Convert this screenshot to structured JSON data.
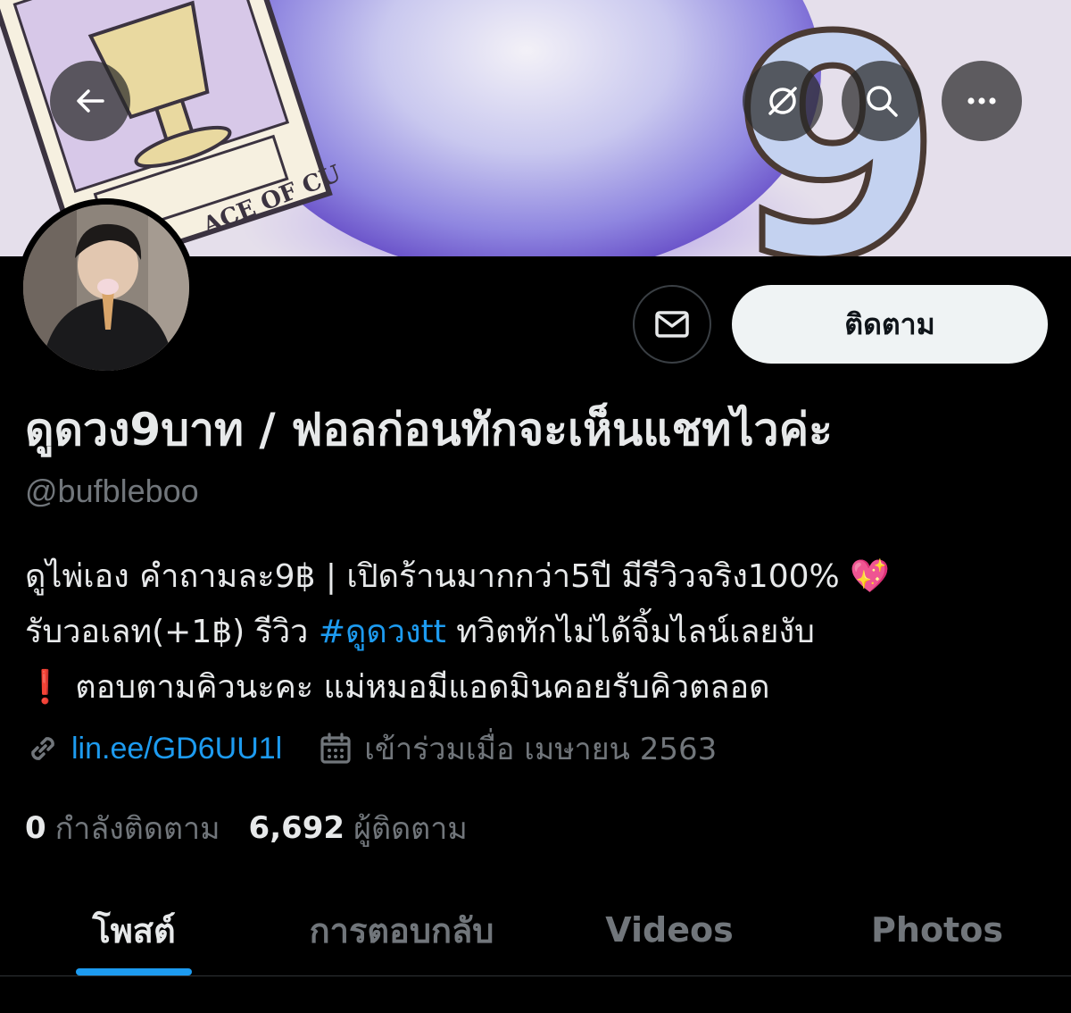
{
  "header": {
    "back_icon": "arrow-left-icon",
    "actions": [
      {
        "icon": "no-notification-icon"
      },
      {
        "icon": "search-icon"
      },
      {
        "icon": "more-horizontal-icon"
      }
    ]
  },
  "banner": {
    "card_text": "ACE OF CU",
    "big_digit": "9"
  },
  "actions": {
    "message_icon": "envelope-icon",
    "follow_label": "ติดตาม"
  },
  "profile": {
    "display_name": "ดูดวง9บาท / ฟอลก่อนทักจะเห็นแชทไวค่ะ",
    "handle": "@bufbleboo",
    "bio": {
      "line1": "ดูไพ่เอง คำถามละ9฿ | เปิดร้านมากกว่า5ปี มีรีวิวจริง100%",
      "line1_emoji": "💖",
      "line2_before": "รับวอเลท(+1฿) รีวิว ",
      "line2_hashtag": "#ดูดวงtt",
      "line2_after": " ทวิตทักไม่ได้จิ้มไลน์เลยงับ",
      "line3_emoji": "❗",
      "line3": " ตอบตามคิวนะคะ แม่หมอมีแอดมินคอยรับคิวตลอด"
    },
    "link": "lin.ee/GD6UU1l",
    "joined": "เข้าร่วมเมื่อ เมษายน 2563",
    "following_count": "0",
    "following_label": "กำลังติดตาม",
    "followers_count": "6,692",
    "followers_label": "ผู้ติดตาม"
  },
  "tabs": [
    {
      "label": "โพสต์",
      "active": true
    },
    {
      "label": "การตอบกลับ",
      "active": false
    },
    {
      "label": "Videos",
      "active": false
    },
    {
      "label": "Photos",
      "active": false
    }
  ],
  "colors": {
    "accent": "#1d9bf0",
    "background": "#000000",
    "muted": "#71767b",
    "text": "#e7e9ea"
  }
}
